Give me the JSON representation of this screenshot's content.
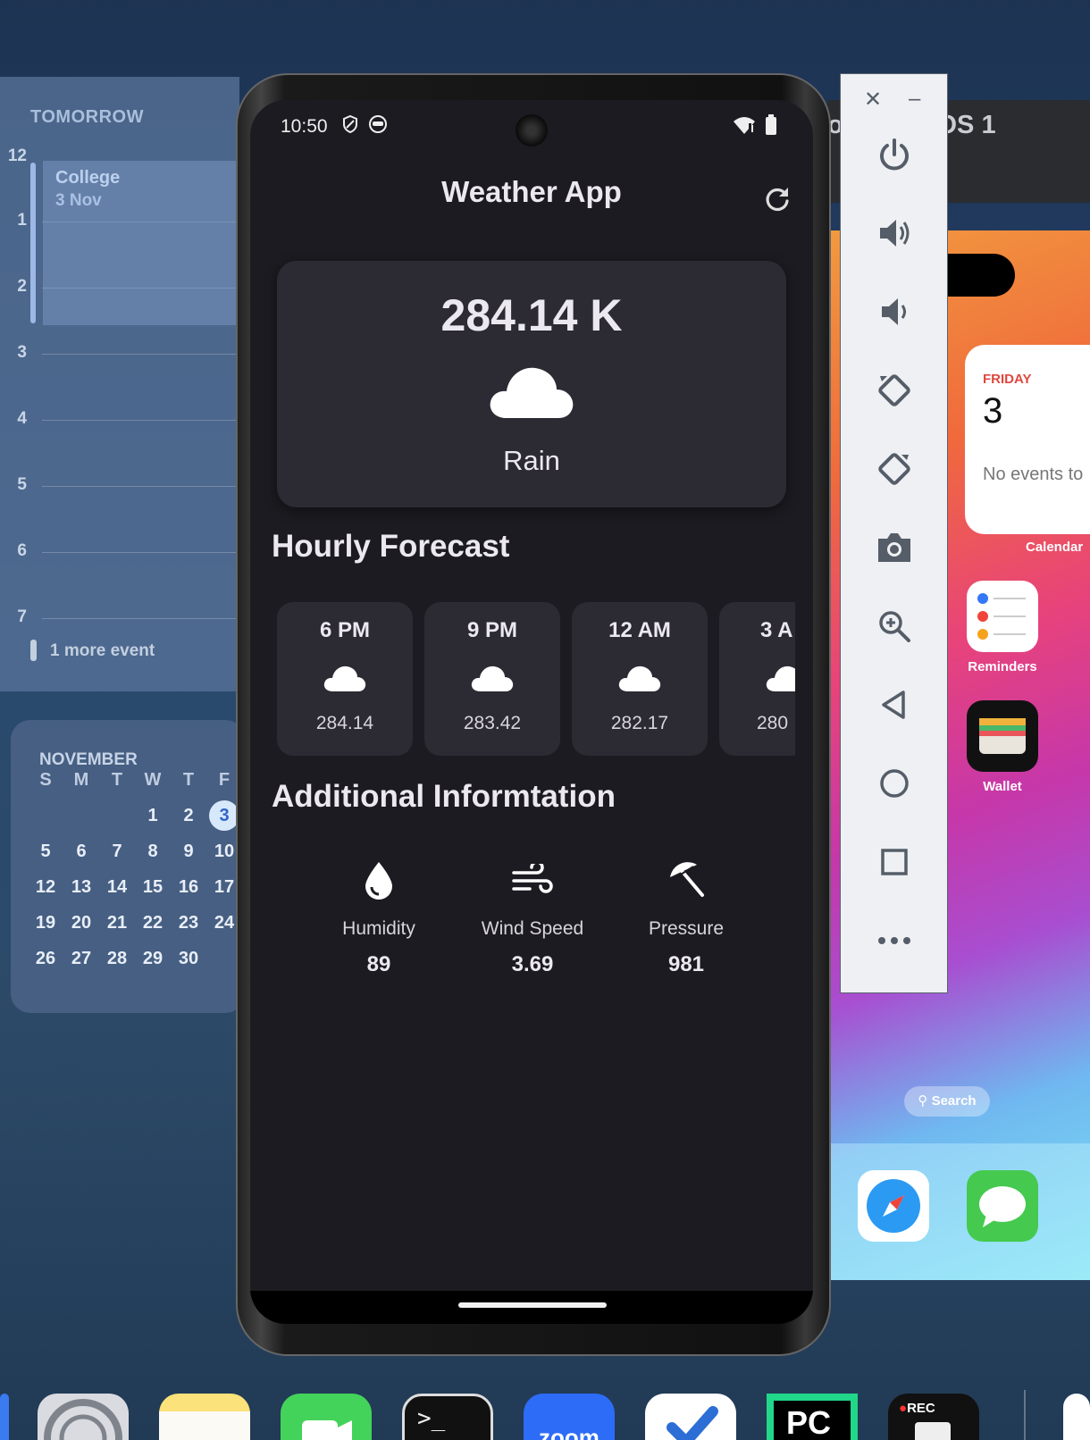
{
  "calendar_widget": {
    "heading": "TOMORROW",
    "hours": [
      "12",
      "1",
      "2",
      "3",
      "4",
      "5",
      "6",
      "7"
    ],
    "event": {
      "title": "College",
      "date": "3 Nov"
    },
    "more": "1 more event"
  },
  "month_widget": {
    "title": "NOVEMBER",
    "weekdays": [
      "S",
      "M",
      "T",
      "W",
      "T",
      "F"
    ],
    "weeks": [
      [
        "",
        "",
        "",
        "1",
        "2",
        "3"
      ],
      [
        "5",
        "6",
        "7",
        "8",
        "9",
        "10"
      ],
      [
        "12",
        "13",
        "14",
        "15",
        "16",
        "17"
      ],
      [
        "19",
        "20",
        "21",
        "22",
        "23",
        "24"
      ],
      [
        "26",
        "27",
        "28",
        "29",
        "30",
        ""
      ]
    ],
    "today": "3"
  },
  "phone": {
    "status": {
      "time": "10:50"
    },
    "app_title": "Weather App",
    "current": {
      "temperature": "284.14 K",
      "condition": "Rain"
    },
    "hourly_title": "Hourly Forecast",
    "hourly": [
      {
        "time": "6 PM",
        "temp": "284.14"
      },
      {
        "time": "9 PM",
        "temp": "283.42"
      },
      {
        "time": "12 AM",
        "temp": "282.17"
      },
      {
        "time": "3 A",
        "temp": "280"
      }
    ],
    "additional_title": "Additional Informtation",
    "info": [
      {
        "label": "Humidity",
        "value": "89",
        "icon": "water-drop-icon"
      },
      {
        "label": "Wind Speed",
        "value": "3.69",
        "icon": "air-icon"
      },
      {
        "label": "Pressure",
        "value": "981",
        "icon": "beach-umbrella-icon"
      }
    ]
  },
  "ios_sim": {
    "title": "o Max – iOS 1",
    "widget": {
      "day": "FRIDAY",
      "date": "3",
      "empty": "No events to",
      "label": "Calendar"
    },
    "apps": [
      "Reminders",
      "Wallet"
    ],
    "search": "Search"
  },
  "dock": {
    "rec_label": "REC",
    "pc_label": "PC",
    "zoom_label": "zoom"
  },
  "colors": {
    "phone_bg": "#1c1b21",
    "card_bg": "#2c2a33",
    "text": "#ece8f0"
  }
}
